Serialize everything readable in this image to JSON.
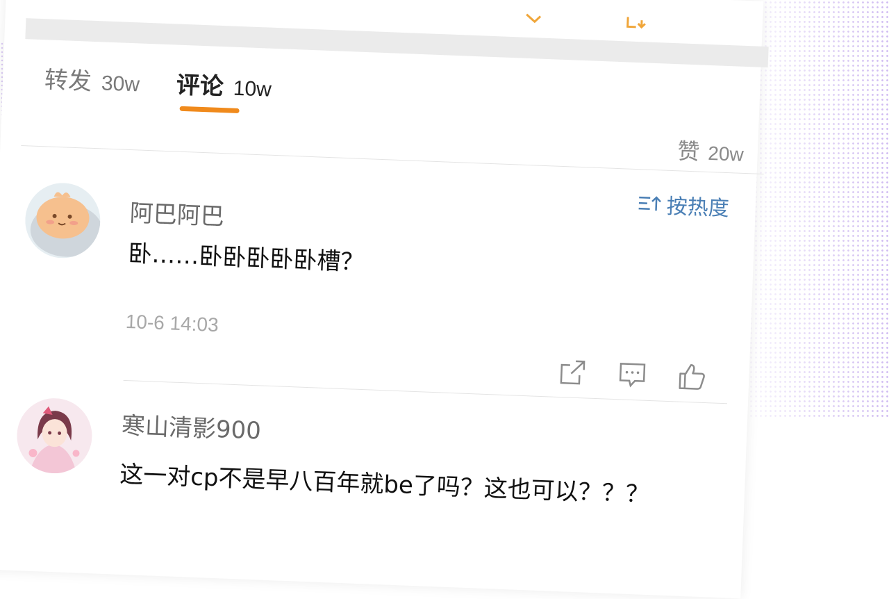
{
  "tabs": {
    "repost": {
      "label": "转发",
      "count": "30w"
    },
    "comments": {
      "label": "评论",
      "count": "10w"
    }
  },
  "likes": {
    "label": "赞",
    "count": "20w"
  },
  "sort": {
    "label": "按热度"
  },
  "comments": [
    {
      "username": "阿巴阿巴",
      "text": "卧……卧卧卧卧卧槽？",
      "time": "10-6 14:03"
    },
    {
      "username": "寒山清影900",
      "text": "这一对cp不是早八百年就be了吗？这也可以？？？"
    }
  ],
  "colors": {
    "accent": "#f08a1c",
    "link": "#4a7fb5",
    "decoration": "#a882e6"
  },
  "icons": [
    "share-icon",
    "comment-icon",
    "like-icon",
    "sort-icon"
  ]
}
